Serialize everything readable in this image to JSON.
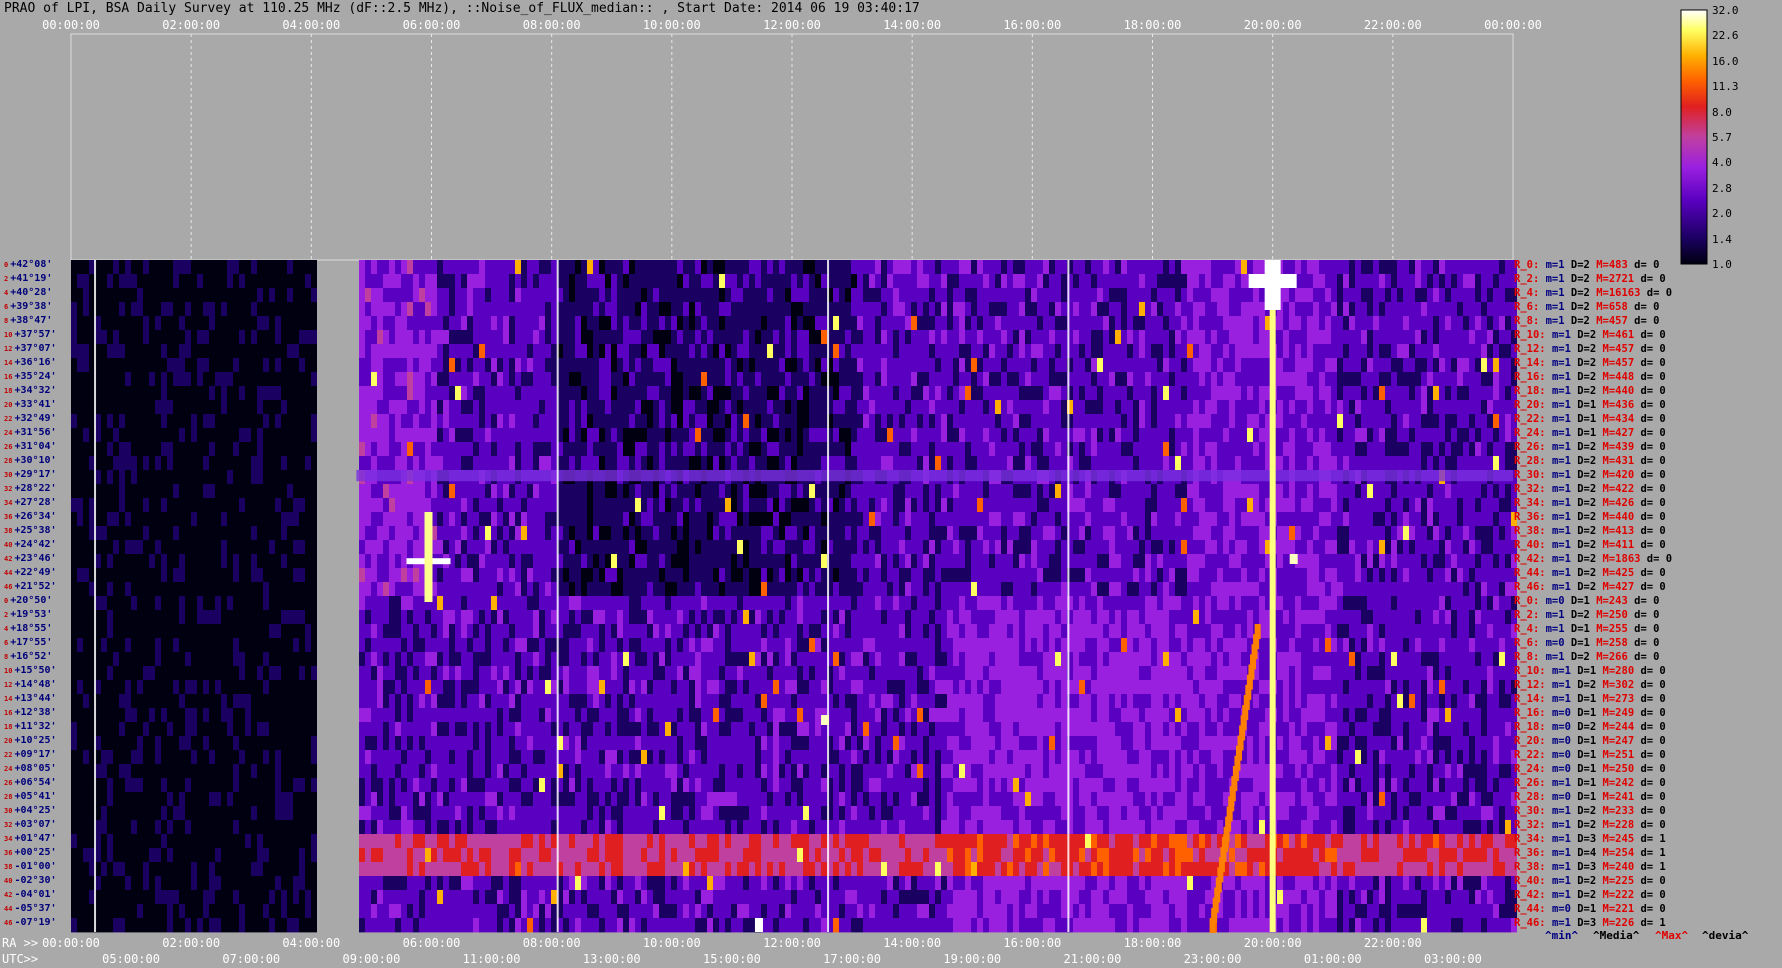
{
  "title": "PRAO of LPI, BSA Daily Survey at 110.25 MHz (dF::2.5 MHz), ::Noise_of_FLUX_median:: , Start Date: 2014 06 19 03:40:17",
  "chart_data": {
    "type": "heatmap",
    "top_axis_ticks": [
      "00:00:00",
      "02:00:00",
      "04:00:00",
      "06:00:00",
      "08:00:00",
      "10:00:00",
      "12:00:00",
      "14:00:00",
      "16:00:00",
      "18:00:00",
      "20:00:00",
      "22:00:00",
      "00:00:00"
    ],
    "ra_axis_label": "RA >>",
    "ra_ticks": [
      "00:00:00",
      "02:00:00",
      "04:00:00",
      "06:00:00",
      "08:00:00",
      "10:00:00",
      "12:00:00",
      "14:00:00",
      "16:00:00",
      "18:00:00",
      "20:00:00",
      "22:00:00"
    ],
    "utc_axis_label": "UTC>>",
    "utc_ticks": [
      "05:00:00",
      "07:00:00",
      "09:00:00",
      "11:00:00",
      "13:00:00",
      "15:00:00",
      "17:00:00",
      "19:00:00",
      "21:00:00",
      "23:00:00",
      "01:00:00",
      "03:00:00"
    ],
    "colorbar_ticks": [
      "32.0",
      "22.6",
      "16.0",
      "11.3",
      "8.0",
      "5.7",
      "4.0",
      "2.8",
      "2.0",
      "1.4",
      "1.0"
    ],
    "colorbar_colors": [
      "#000010",
      "#1a0060",
      "#5a00c0",
      "#9a20e0",
      "#c040a0",
      "#e02020",
      "#ff6000",
      "#ffb000",
      "#ffff60",
      "#ffffff"
    ],
    "declinations": [
      "+42°08'",
      "+41°19'",
      "+40°28'",
      "+39°38'",
      "+38°47'",
      "+37°57'",
      "+37°07'",
      "+36°16'",
      "+35°24'",
      "+34°32'",
      "+33°41'",
      "+32°49'",
      "+31°56'",
      "+31°04'",
      "+30°10'",
      "+29°17'",
      "+28°22'",
      "+27°28'",
      "+26°34'",
      "+25°38'",
      "+24°42'",
      "+23°46'",
      "+22°49'",
      "+21°52'",
      "+20°50'",
      "+19°53'",
      "+18°55'",
      "+17°55'",
      "+16°52'",
      "+15°50'",
      "+14°48'",
      "+13°44'",
      "+12°38'",
      "+11°32'",
      "+10°25'",
      "+09°17'",
      "+08°05'",
      "+06°54'",
      "+05°41'",
      "+04°25'",
      "+03°07'",
      "+01°47'",
      "+00°25'",
      "-01°00'",
      "-02°30'",
      "-04°01'",
      "-05°37'",
      "-07°19'"
    ],
    "row_index_labels": [
      "0",
      "2",
      "4",
      "6",
      "8",
      "10",
      "12",
      "14",
      "16",
      "18",
      "20",
      "22",
      "24",
      "26",
      "28",
      "30",
      "32",
      "34",
      "36",
      "38",
      "40",
      "42",
      "44",
      "46",
      "0",
      "2",
      "4",
      "6",
      "8",
      "10",
      "12",
      "14",
      "16",
      "18",
      "20",
      "22",
      "24",
      "26",
      "28",
      "30",
      "32",
      "34",
      "36",
      "38",
      "40",
      "42",
      "44",
      "46"
    ],
    "row_stats": [
      {
        "r": "R_0:",
        "m": "m=1",
        "d": "D=2",
        "M": "M=483",
        "dv": "d= 0"
      },
      {
        "r": "R_2:",
        "m": "m=1",
        "d": "D=2",
        "M": "M=2721",
        "dv": "d= 0"
      },
      {
        "r": "R_4:",
        "m": "m=1",
        "d": "D=2",
        "M": "M=16163",
        "dv": "d= 0"
      },
      {
        "r": "R_6:",
        "m": "m=1",
        "d": "D=2",
        "M": "M=658",
        "dv": "d= 0"
      },
      {
        "r": "R_8:",
        "m": "m=1",
        "d": "D=2",
        "M": "M=457",
        "dv": "d= 0"
      },
      {
        "r": "R_10:",
        "m": "m=1",
        "d": "D=2",
        "M": "M=461",
        "dv": "d= 0"
      },
      {
        "r": "R_12:",
        "m": "m=1",
        "d": "D=2",
        "M": "M=457",
        "dv": "d= 0"
      },
      {
        "r": "R_14:",
        "m": "m=1",
        "d": "D=2",
        "M": "M=457",
        "dv": "d= 0"
      },
      {
        "r": "R_16:",
        "m": "m=1",
        "d": "D=2",
        "M": "M=448",
        "dv": "d= 0"
      },
      {
        "r": "R_18:",
        "m": "m=1",
        "d": "D=2",
        "M": "M=440",
        "dv": "d= 0"
      },
      {
        "r": "R_20:",
        "m": "m=1",
        "d": "D=1",
        "M": "M=436",
        "dv": "d= 0"
      },
      {
        "r": "R_22:",
        "m": "m=1",
        "d": "D=1",
        "M": "M=434",
        "dv": "d= 0"
      },
      {
        "r": "R_24:",
        "m": "m=1",
        "d": "D=1",
        "M": "M=427",
        "dv": "d= 0"
      },
      {
        "r": "R_26:",
        "m": "m=1",
        "d": "D=2",
        "M": "M=439",
        "dv": "d= 0"
      },
      {
        "r": "R_28:",
        "m": "m=1",
        "d": "D=2",
        "M": "M=431",
        "dv": "d= 0"
      },
      {
        "r": "R_30:",
        "m": "m=1",
        "d": "D=2",
        "M": "M=420",
        "dv": "d= 0"
      },
      {
        "r": "R_32:",
        "m": "m=1",
        "d": "D=2",
        "M": "M=422",
        "dv": "d= 0"
      },
      {
        "r": "R_34:",
        "m": "m=1",
        "d": "D=2",
        "M": "M=426",
        "dv": "d= 0"
      },
      {
        "r": "R_36:",
        "m": "m=1",
        "d": "D=2",
        "M": "M=440",
        "dv": "d= 0"
      },
      {
        "r": "R_38:",
        "m": "m=1",
        "d": "D=2",
        "M": "M=413",
        "dv": "d= 0"
      },
      {
        "r": "R_40:",
        "m": "m=1",
        "d": "D=2",
        "M": "M=411",
        "dv": "d= 0"
      },
      {
        "r": "R_42:",
        "m": "m=1",
        "d": "D=2",
        "M": "M=1863",
        "dv": "d= 0"
      },
      {
        "r": "R_44:",
        "m": "m=1",
        "d": "D=2",
        "M": "M=425",
        "dv": "d= 0"
      },
      {
        "r": "R_46:",
        "m": "m=1",
        "d": "D=2",
        "M": "M=427",
        "dv": "d= 0"
      },
      {
        "r": "R_0:",
        "m": "m=0",
        "d": "D=1",
        "M": "M=243",
        "dv": "d= 0"
      },
      {
        "r": "R_2:",
        "m": "m=1",
        "d": "D=2",
        "M": "M=250",
        "dv": "d= 0"
      },
      {
        "r": "R_4:",
        "m": "m=1",
        "d": "D=1",
        "M": "M=255",
        "dv": "d= 0"
      },
      {
        "r": "R_6:",
        "m": "m=0",
        "d": "D=1",
        "M": "M=258",
        "dv": "d= 0"
      },
      {
        "r": "R_8:",
        "m": "m=1",
        "d": "D=2",
        "M": "M=266",
        "dv": "d= 0"
      },
      {
        "r": "R_10:",
        "m": "m=1",
        "d": "D=1",
        "M": "M=280",
        "dv": "d= 0"
      },
      {
        "r": "R_12:",
        "m": "m=1",
        "d": "D=2",
        "M": "M=302",
        "dv": "d= 0"
      },
      {
        "r": "R_14:",
        "m": "m=1",
        "d": "D=1",
        "M": "M=273",
        "dv": "d= 0"
      },
      {
        "r": "R_16:",
        "m": "m=0",
        "d": "D=1",
        "M": "M=249",
        "dv": "d= 0"
      },
      {
        "r": "R_18:",
        "m": "m=0",
        "d": "D=2",
        "M": "M=244",
        "dv": "d= 0"
      },
      {
        "r": "R_20:",
        "m": "m=0",
        "d": "D=1",
        "M": "M=247",
        "dv": "d= 0"
      },
      {
        "r": "R_22:",
        "m": "m=0",
        "d": "D=1",
        "M": "M=251",
        "dv": "d= 0"
      },
      {
        "r": "R_24:",
        "m": "m=0",
        "d": "D=1",
        "M": "M=250",
        "dv": "d= 0"
      },
      {
        "r": "R_26:",
        "m": "m=1",
        "d": "D=1",
        "M": "M=242",
        "dv": "d= 0"
      },
      {
        "r": "R_28:",
        "m": "m=0",
        "d": "D=1",
        "M": "M=241",
        "dv": "d= 0"
      },
      {
        "r": "R_30:",
        "m": "m=1",
        "d": "D=2",
        "M": "M=233",
        "dv": "d= 0"
      },
      {
        "r": "R_32:",
        "m": "m=1",
        "d": "D=2",
        "M": "M=228",
        "dv": "d= 0"
      },
      {
        "r": "R_34:",
        "m": "m=1",
        "d": "D=3",
        "M": "M=245",
        "dv": "d= 1"
      },
      {
        "r": "R_36:",
        "m": "m=1",
        "d": "D=4",
        "M": "M=254",
        "dv": "d= 1"
      },
      {
        "r": "R_38:",
        "m": "m=1",
        "d": "D=3",
        "M": "M=240",
        "dv": "d= 1"
      },
      {
        "r": "R_40:",
        "m": "m=1",
        "d": "D=2",
        "M": "M=225",
        "dv": "d= 0"
      },
      {
        "r": "R_42:",
        "m": "m=1",
        "d": "D=2",
        "M": "M=222",
        "dv": "d= 0"
      },
      {
        "r": "R_44:",
        "m": "m=0",
        "d": "D=1",
        "M": "M=221",
        "dv": "d= 0"
      },
      {
        "r": "R_46:",
        "m": "m=1",
        "d": "D=3",
        "M": "M=226",
        "dv": "d= 1"
      }
    ],
    "legend": [
      {
        "label": "^min^",
        "color": "#000080"
      },
      {
        "label": "^Media^",
        "color": "#000000"
      },
      {
        "label": "^Max^",
        "color": "#e00000"
      },
      {
        "label": "^devia^",
        "color": "#000000"
      }
    ]
  }
}
